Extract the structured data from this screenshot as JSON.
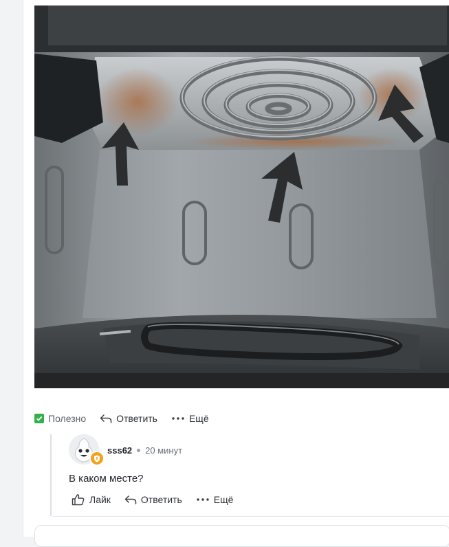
{
  "post": {
    "image_alt": "Фото внутренней камеры аэрогриля с ржавчиной у верхнего нагревателя"
  },
  "post_actions": {
    "useful_label": "Полезно",
    "reply_label": "Ответить",
    "more_label": "Ещё"
  },
  "reply": {
    "author": "sss62",
    "time": "20 минут",
    "text": "В каком месте?",
    "like_label": "Лайк",
    "reply_label": "Ответить",
    "more_label": "Ещё"
  },
  "colors": {
    "accent_green": "#35b04a",
    "badge_orange": "#f3a21b",
    "text_main": "#1f2329"
  },
  "icons": [
    "checkbox-checked-icon",
    "reply-arrow-icon",
    "more-dots-icon",
    "like-hand-icon",
    "avatar-mascot-icon",
    "badge-shield-icon"
  ]
}
